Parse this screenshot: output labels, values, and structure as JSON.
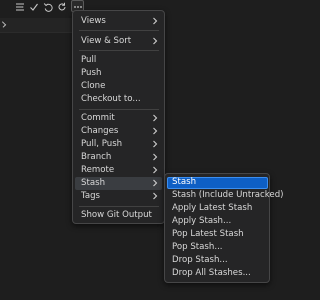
{
  "toolbar": {
    "icons": [
      "list-icon",
      "check-icon",
      "undo-icon",
      "refresh-icon",
      "more-icon"
    ]
  },
  "menu": {
    "items": [
      {
        "label": "Views",
        "submenu": true
      },
      {
        "label": "View & Sort",
        "submenu": true
      },
      {
        "label": "Pull",
        "submenu": false
      },
      {
        "label": "Push",
        "submenu": false
      },
      {
        "label": "Clone",
        "submenu": false
      },
      {
        "label": "Checkout to...",
        "submenu": false
      },
      {
        "label": "Commit",
        "submenu": true
      },
      {
        "label": "Changes",
        "submenu": true
      },
      {
        "label": "Pull, Push",
        "submenu": true
      },
      {
        "label": "Branch",
        "submenu": true
      },
      {
        "label": "Remote",
        "submenu": true
      },
      {
        "label": "Stash",
        "submenu": true,
        "active": true
      },
      {
        "label": "Tags",
        "submenu": true
      },
      {
        "label": "Show Git Output",
        "submenu": false
      }
    ]
  },
  "stash_submenu": {
    "items": [
      {
        "label": "Stash",
        "active": true
      },
      {
        "label": "Stash (Include Untracked)"
      },
      {
        "label": "Apply Latest Stash"
      },
      {
        "label": "Apply Stash..."
      },
      {
        "label": "Pop Latest Stash"
      },
      {
        "label": "Pop Stash..."
      },
      {
        "label": "Drop Stash..."
      },
      {
        "label": "Drop All Stashes..."
      }
    ]
  },
  "colors": {
    "background": "#1e1e1e",
    "menu_bg": "#252526",
    "highlight": "#0e5fc5"
  }
}
